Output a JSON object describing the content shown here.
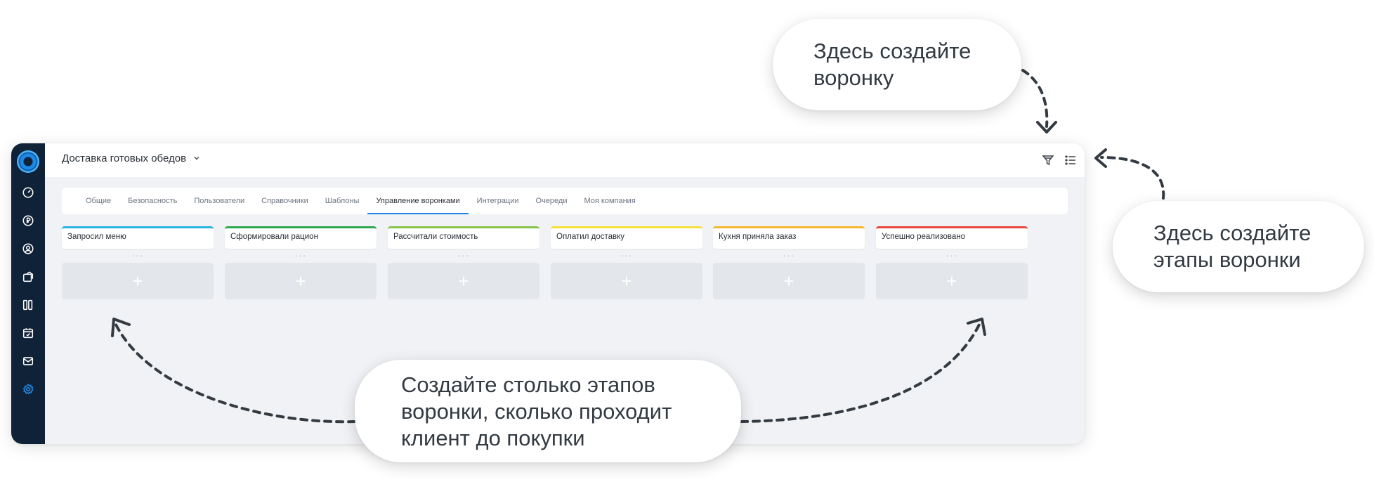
{
  "app": {
    "pipeline_name": "Доставка готовых обедов"
  },
  "sidebar": {
    "items": [
      {
        "icon": "dashboard-icon"
      },
      {
        "icon": "currency-icon"
      },
      {
        "icon": "contacts-icon"
      },
      {
        "icon": "deals-icon"
      },
      {
        "icon": "kanban-icon"
      },
      {
        "icon": "calendar-icon"
      },
      {
        "icon": "mail-icon"
      },
      {
        "icon": "settings-icon",
        "active": true
      }
    ]
  },
  "header": {
    "tools": [
      "filter-icon",
      "list-view-icon"
    ]
  },
  "tabs": [
    {
      "label": "Общие"
    },
    {
      "label": "Безопасность"
    },
    {
      "label": "Пользователи"
    },
    {
      "label": "Справочники"
    },
    {
      "label": "Шаблоны"
    },
    {
      "label": "Управление воронками",
      "active": true
    },
    {
      "label": "Интеграции"
    },
    {
      "label": "Очереди"
    },
    {
      "label": "Моя компания"
    }
  ],
  "stages": [
    {
      "title": "Запросил меню",
      "color": "#2ab4e0",
      "more": "···",
      "add": "+"
    },
    {
      "title": "Сформировали рацион",
      "color": "#2ea84f",
      "more": "···",
      "add": "+"
    },
    {
      "title": "Рассчитали стоимость",
      "color": "#8bc34a",
      "more": "···",
      "add": "+"
    },
    {
      "title": "Оплатил доставку",
      "color": "#f3e03a",
      "more": "···",
      "add": "+"
    },
    {
      "title": "Кухня приняла заказ",
      "color": "#f5b82e",
      "more": "···",
      "add": "+"
    },
    {
      "title": "Успешно реализовано",
      "color": "#e8473e",
      "more": "···",
      "add": "+"
    }
  ],
  "callouts": {
    "create_pipeline": [
      "Здесь создайте",
      "воронку"
    ],
    "create_stages": [
      "Здесь создайте",
      "этапы воронки"
    ],
    "stages_hint": [
      "Создайте столько этапов",
      "воронки, сколько проходит",
      "клиент до покупки"
    ]
  },
  "colors": {
    "sidebar_bg": "#0f2237",
    "accent": "#1e88e5",
    "canvas_bg": "#f0f2f5"
  }
}
